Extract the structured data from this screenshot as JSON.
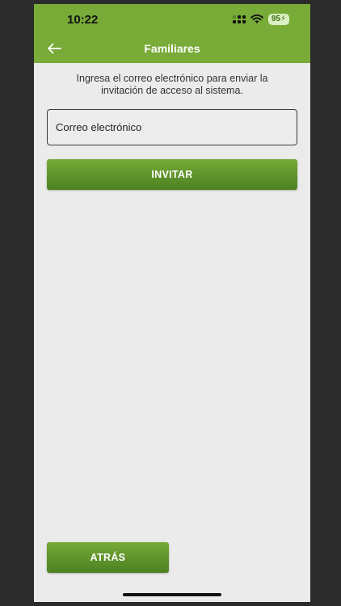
{
  "status_bar": {
    "time": "10:22",
    "battery": "95",
    "icons": [
      "signal-icon",
      "wifi-icon",
      "battery-icon"
    ]
  },
  "header": {
    "title": "Familiares",
    "back_icon": "back-arrow-icon"
  },
  "form": {
    "instruction": "Ingresa el correo electrónico para enviar la invitación de acceso al sistema.",
    "email_placeholder": "Correo electrónico",
    "email_value": "",
    "invite_label": "INVITAR"
  },
  "footer": {
    "back_label": "ATRÁS"
  },
  "colors": {
    "header": "#78ab37",
    "button": "#5f932b",
    "background": "#ebebeb"
  }
}
